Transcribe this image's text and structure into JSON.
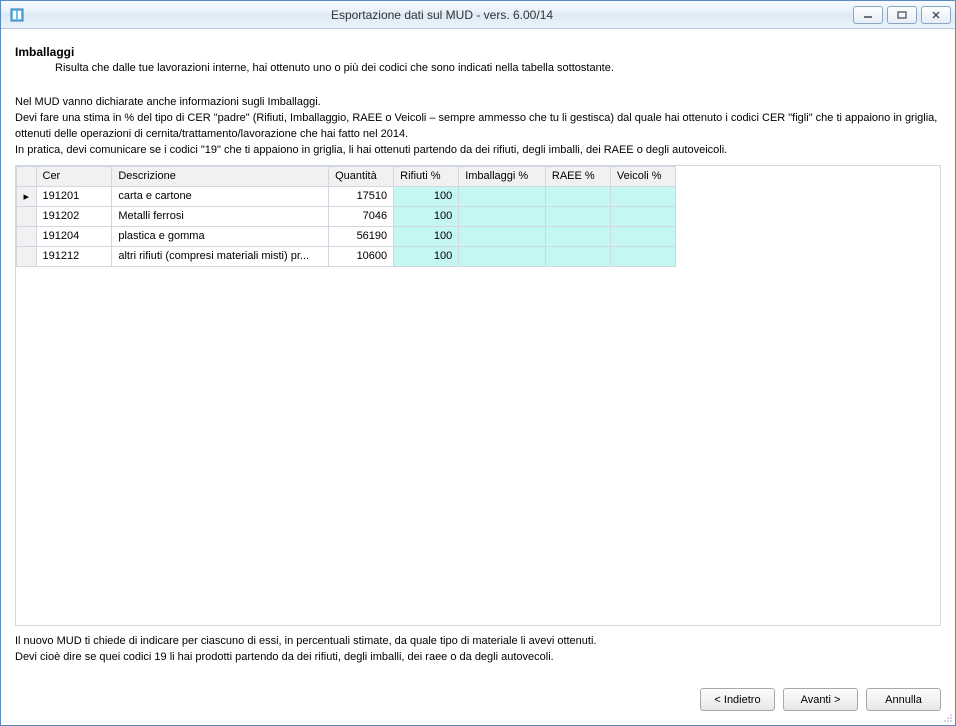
{
  "window": {
    "title": "Esportazione dati sul MUD - vers. 6.00/14"
  },
  "page": {
    "heading": "Imballaggi",
    "subheading": "Risulta che dalle tue lavorazioni interne, hai ottenuto uno o più dei codici che sono indicati nella tabella sottostante.",
    "intro_line1": "Nel MUD vanno dichiarate anche informazioni sugli Imballaggi.",
    "intro_line2": "Devi fare una stima in % del tipo di CER \"padre\" (Rifiuti, Imballaggio, RAEE o  Veicoli – sempre ammesso che tu li gestisca) dal quale hai ottenuto i codici CER \"figli\" che ti appaiono in griglia, ottenuti delle operazioni di cernita/trattamento/lavorazione che hai fatto nel 2014.",
    "intro_line3": "In pratica, devi comunicare se i codici \"19\" che ti appaiono in griglia, li hai ottenuti partendo da dei rifiuti, degli imballi, dei RAEE o degli autoveicoli.",
    "footer_line1": "Il nuovo MUD ti chiede di indicare per ciascuno di essi, in percentuali stimate, da quale tipo di materiale li avevi ottenuti.",
    "footer_line2": "Devi cioè dire se quei codici 19 li hai prodotti partendo da dei rifiuti, degli imballi, dei raee o da degli autovecoli."
  },
  "grid": {
    "columns": {
      "cer": "Cer",
      "descrizione": "Descrizione",
      "quantita": "Quantità",
      "rifiuti": "Rifiuti %",
      "imballaggi": "Imballaggi %",
      "raee": "RAEE %",
      "veicoli": "Veicoli %"
    },
    "rows": [
      {
        "cer": "191201",
        "descrizione": "carta e cartone",
        "quantita": "17510",
        "rifiuti": "100",
        "imballaggi": "",
        "raee": "",
        "veicoli": ""
      },
      {
        "cer": "191202",
        "descrizione": "Metalli ferrosi",
        "quantita": "7046",
        "rifiuti": "100",
        "imballaggi": "",
        "raee": "",
        "veicoli": ""
      },
      {
        "cer": "191204",
        "descrizione": "plastica e gomma",
        "quantita": "56190",
        "rifiuti": "100",
        "imballaggi": "",
        "raee": "",
        "veicoli": ""
      },
      {
        "cer": "191212",
        "descrizione": "altri rifiuti (compresi materiali misti) pr...",
        "quantita": "10600",
        "rifiuti": "100",
        "imballaggi": "",
        "raee": "",
        "veicoli": ""
      }
    ]
  },
  "buttons": {
    "back": "< Indietro",
    "next": "Avanti >",
    "cancel": "Annulla"
  }
}
